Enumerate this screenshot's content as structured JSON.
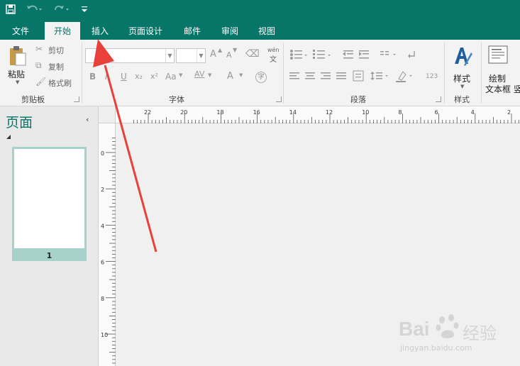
{
  "quick_access": {
    "save_icon": "save-icon",
    "undo_icon": "undo-icon",
    "redo_icon": "redo-icon",
    "customize_icon": "customize-qat-icon"
  },
  "tabs": [
    {
      "label": "文件",
      "active": false
    },
    {
      "label": "开始",
      "active": true
    },
    {
      "label": "插入",
      "active": false
    },
    {
      "label": "页面设计",
      "active": false
    },
    {
      "label": "邮件",
      "active": false
    },
    {
      "label": "审阅",
      "active": false
    },
    {
      "label": "视图",
      "active": false
    }
  ],
  "ribbon": {
    "clipboard": {
      "paste_label": "粘贴",
      "cut_label": "剪切",
      "copy_label": "复制",
      "format_painter_label": "格式刷",
      "group_label": "剪贴板"
    },
    "font": {
      "font_name_value": "",
      "font_size_value": "",
      "phonetic_label": "wén",
      "phonetic_char": "文",
      "bold": "B",
      "italic": "I",
      "underline": "U",
      "subscript": "x₂",
      "superscript": "x²",
      "change_case": "Aa",
      "char_spacing": "AV",
      "font_color": "A",
      "enclose_char": "字",
      "grow_font": "A",
      "shrink_font": "A",
      "group_label": "字体"
    },
    "paragraph": {
      "group_label": "段落",
      "numbering_sample": "123"
    },
    "styles": {
      "styles_label": "样式",
      "group_label": "样式"
    },
    "objects": {
      "draw_textbox_label_1": "绘制",
      "draw_textbox_label_2": "文本框",
      "draw_textbox_label_3": "竖"
    }
  },
  "pages_pane": {
    "title": "页面",
    "page_number": "1"
  },
  "rulers": {
    "horizontal_labels": [
      "22",
      "20",
      "18",
      "16",
      "14",
      "12",
      "10",
      "8",
      "6",
      "4",
      "2"
    ],
    "vertical_labels": [
      "0",
      "2",
      "4",
      "6",
      "8",
      "10"
    ]
  },
  "watermark": {
    "brand": "Bai",
    "brand_suffix": "经验",
    "url": "jingyan.baidu.com"
  },
  "colors": {
    "accent": "#077568",
    "annotation_arrow": "#e8403a"
  }
}
